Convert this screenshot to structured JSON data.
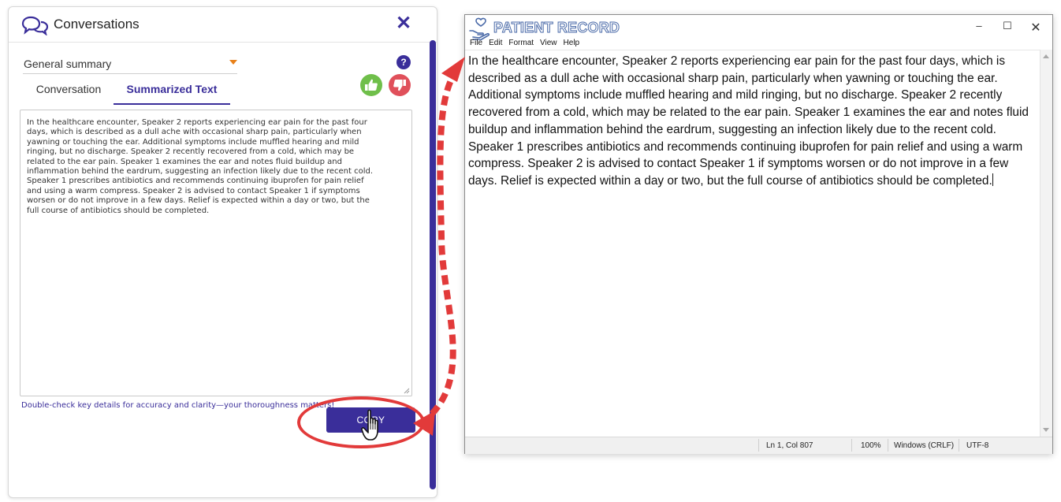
{
  "conversations": {
    "title": "Conversations",
    "close_glyph": "✕",
    "summary_select": {
      "selected": "General summary"
    },
    "help_glyph": "?",
    "tabs": [
      {
        "label": "Conversation",
        "active": false
      },
      {
        "label": "Summarized Text",
        "active": true
      }
    ],
    "summary_text": "In the healthcare encounter, Speaker 2 reports experiencing ear pain for the past four\ndays, which is described as a dull ache with occasional sharp pain, particularly when\nyawning or touching the ear. Additional symptoms include muffled hearing and mild\nringing, but no discharge. Speaker 2 recently recovered from a cold, which may be\nrelated to the ear pain. Speaker 1 examines the ear and notes fluid buildup and\ninflammation behind the eardrum, suggesting an infection likely due to the recent cold.\nSpeaker 1 prescribes antibiotics and recommends continuing ibuprofen for pain relief\nand using a warm compress. Speaker 2 is advised to contact Speaker 1 if symptoms\nworsen or do not improve in a few days. Relief is expected within a day or two, but the\nfull course of antibiotics should be completed.",
    "tip": "Double-check key details for accuracy and clarity—your thoroughness matters!",
    "copy_label": "COPY",
    "colors": {
      "accent": "#3a2e9a",
      "thumb_up": "#6fbf4a",
      "thumb_down": "#e0505b",
      "highlight": "#e23a3a",
      "select_caret": "#e8811a"
    }
  },
  "notepad": {
    "title": "PATIENT RECORD",
    "window_controls": {
      "minimize": "–",
      "maximize": "☐",
      "close": "✕"
    },
    "menu": [
      "File",
      "Edit",
      "Format",
      "View",
      "Help"
    ],
    "body_text": "In the healthcare encounter, Speaker 2 reports experiencing ear pain for the past four days, which is\ndescribed as a dull ache with occasional sharp pain, particularly when yawning or touching the ear.\nAdditional symptoms include muffled hearing and mild ringing, but no discharge. Speaker 2 recently\nrecovered from a cold, which may be related to the ear pain. Speaker 1 examines the ear and notes fluid\nbuildup and inflammation behind the eardrum, suggesting an infection likely due to the recent cold.\nSpeaker 1 prescribes antibiotics and recommends continuing ibuprofen for pain relief and using a warm\ncompress. Speaker 2 is advised to contact Speaker 1 if symptoms worsen or do not improve in a few\ndays. Relief is expected within a day or two, but the full course of antibiotics should be completed.",
    "status": {
      "position": "Ln 1, Col 807",
      "zoom": "100%",
      "line_ending": "Windows (CRLF)",
      "encoding": "UTF-8"
    }
  }
}
